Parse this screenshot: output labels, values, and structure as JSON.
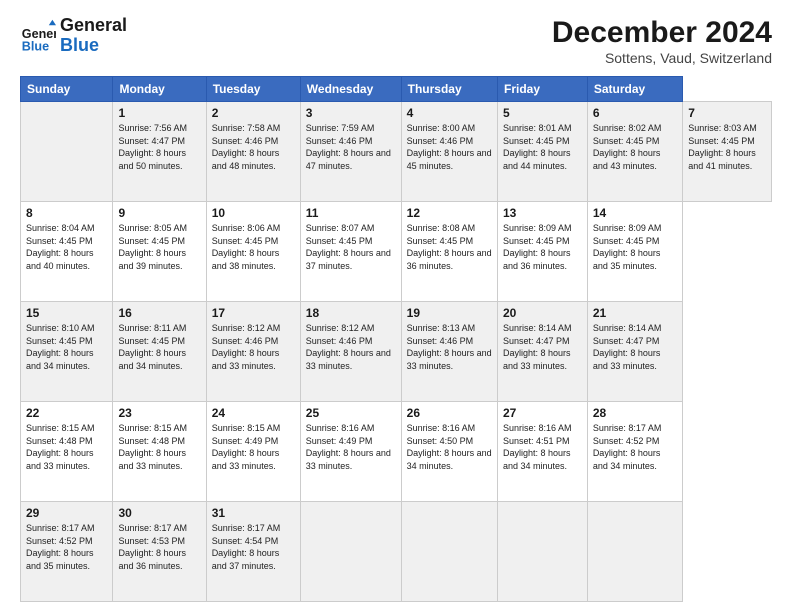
{
  "header": {
    "logo_line1": "General",
    "logo_line2": "Blue",
    "title": "December 2024",
    "subtitle": "Sottens, Vaud, Switzerland"
  },
  "calendar": {
    "days_of_week": [
      "Sunday",
      "Monday",
      "Tuesday",
      "Wednesday",
      "Thursday",
      "Friday",
      "Saturday"
    ],
    "weeks": [
      [
        null,
        {
          "day": 1,
          "rise": "7:56 AM",
          "set": "4:47 PM",
          "daylight": "8 hours and 50 minutes."
        },
        {
          "day": 2,
          "rise": "7:58 AM",
          "set": "4:46 PM",
          "daylight": "8 hours and 48 minutes."
        },
        {
          "day": 3,
          "rise": "7:59 AM",
          "set": "4:46 PM",
          "daylight": "8 hours and 47 minutes."
        },
        {
          "day": 4,
          "rise": "8:00 AM",
          "set": "4:46 PM",
          "daylight": "8 hours and 45 minutes."
        },
        {
          "day": 5,
          "rise": "8:01 AM",
          "set": "4:45 PM",
          "daylight": "8 hours and 44 minutes."
        },
        {
          "day": 6,
          "rise": "8:02 AM",
          "set": "4:45 PM",
          "daylight": "8 hours and 43 minutes."
        },
        {
          "day": 7,
          "rise": "8:03 AM",
          "set": "4:45 PM",
          "daylight": "8 hours and 41 minutes."
        }
      ],
      [
        {
          "day": 8,
          "rise": "8:04 AM",
          "set": "4:45 PM",
          "daylight": "8 hours and 40 minutes."
        },
        {
          "day": 9,
          "rise": "8:05 AM",
          "set": "4:45 PM",
          "daylight": "8 hours and 39 minutes."
        },
        {
          "day": 10,
          "rise": "8:06 AM",
          "set": "4:45 PM",
          "daylight": "8 hours and 38 minutes."
        },
        {
          "day": 11,
          "rise": "8:07 AM",
          "set": "4:45 PM",
          "daylight": "8 hours and 37 minutes."
        },
        {
          "day": 12,
          "rise": "8:08 AM",
          "set": "4:45 PM",
          "daylight": "8 hours and 36 minutes."
        },
        {
          "day": 13,
          "rise": "8:09 AM",
          "set": "4:45 PM",
          "daylight": "8 hours and 36 minutes."
        },
        {
          "day": 14,
          "rise": "8:09 AM",
          "set": "4:45 PM",
          "daylight": "8 hours and 35 minutes."
        }
      ],
      [
        {
          "day": 15,
          "rise": "8:10 AM",
          "set": "4:45 PM",
          "daylight": "8 hours and 34 minutes."
        },
        {
          "day": 16,
          "rise": "8:11 AM",
          "set": "4:45 PM",
          "daylight": "8 hours and 34 minutes."
        },
        {
          "day": 17,
          "rise": "8:12 AM",
          "set": "4:46 PM",
          "daylight": "8 hours and 33 minutes."
        },
        {
          "day": 18,
          "rise": "8:12 AM",
          "set": "4:46 PM",
          "daylight": "8 hours and 33 minutes."
        },
        {
          "day": 19,
          "rise": "8:13 AM",
          "set": "4:46 PM",
          "daylight": "8 hours and 33 minutes."
        },
        {
          "day": 20,
          "rise": "8:14 AM",
          "set": "4:47 PM",
          "daylight": "8 hours and 33 minutes."
        },
        {
          "day": 21,
          "rise": "8:14 AM",
          "set": "4:47 PM",
          "daylight": "8 hours and 33 minutes."
        }
      ],
      [
        {
          "day": 22,
          "rise": "8:15 AM",
          "set": "4:48 PM",
          "daylight": "8 hours and 33 minutes."
        },
        {
          "day": 23,
          "rise": "8:15 AM",
          "set": "4:48 PM",
          "daylight": "8 hours and 33 minutes."
        },
        {
          "day": 24,
          "rise": "8:15 AM",
          "set": "4:49 PM",
          "daylight": "8 hours and 33 minutes."
        },
        {
          "day": 25,
          "rise": "8:16 AM",
          "set": "4:49 PM",
          "daylight": "8 hours and 33 minutes."
        },
        {
          "day": 26,
          "rise": "8:16 AM",
          "set": "4:50 PM",
          "daylight": "8 hours and 34 minutes."
        },
        {
          "day": 27,
          "rise": "8:16 AM",
          "set": "4:51 PM",
          "daylight": "8 hours and 34 minutes."
        },
        {
          "day": 28,
          "rise": "8:17 AM",
          "set": "4:52 PM",
          "daylight": "8 hours and 34 minutes."
        }
      ],
      [
        {
          "day": 29,
          "rise": "8:17 AM",
          "set": "4:52 PM",
          "daylight": "8 hours and 35 minutes."
        },
        {
          "day": 30,
          "rise": "8:17 AM",
          "set": "4:53 PM",
          "daylight": "8 hours and 36 minutes."
        },
        {
          "day": 31,
          "rise": "8:17 AM",
          "set": "4:54 PM",
          "daylight": "8 hours and 37 minutes."
        },
        null,
        null,
        null,
        null
      ]
    ]
  }
}
